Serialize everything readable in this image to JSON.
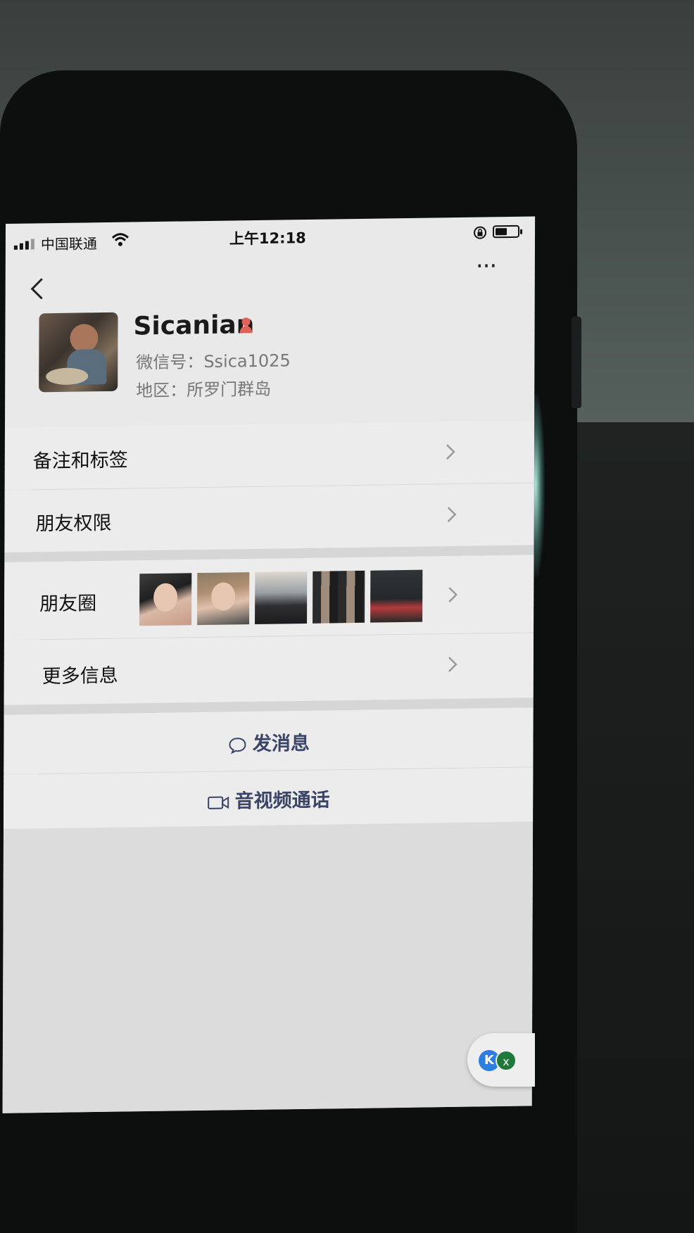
{
  "status_bar": {
    "carrier": "中国联通",
    "time": "上午12:18"
  },
  "nav": {
    "back_icon": "chevron-left-icon",
    "more_icon": "more-dots-icon",
    "more_label": "···"
  },
  "profile": {
    "name": "Sicanian",
    "gender_icon": "female-icon",
    "wechat_id": "微信号：Ssica1025",
    "region": "地区：所罗门群岛"
  },
  "rows": {
    "remarks_tags": "备注和标签",
    "friend_permissions": "朋友权限",
    "moments": "朋友圈",
    "more_info": "更多信息"
  },
  "actions": {
    "send_message": "发消息",
    "av_call": "音视频通话"
  },
  "floating": {
    "k_label": "K",
    "close_label": "x"
  },
  "colors": {
    "action_text": "#3a4466",
    "gender_icon": "#e0625b"
  }
}
